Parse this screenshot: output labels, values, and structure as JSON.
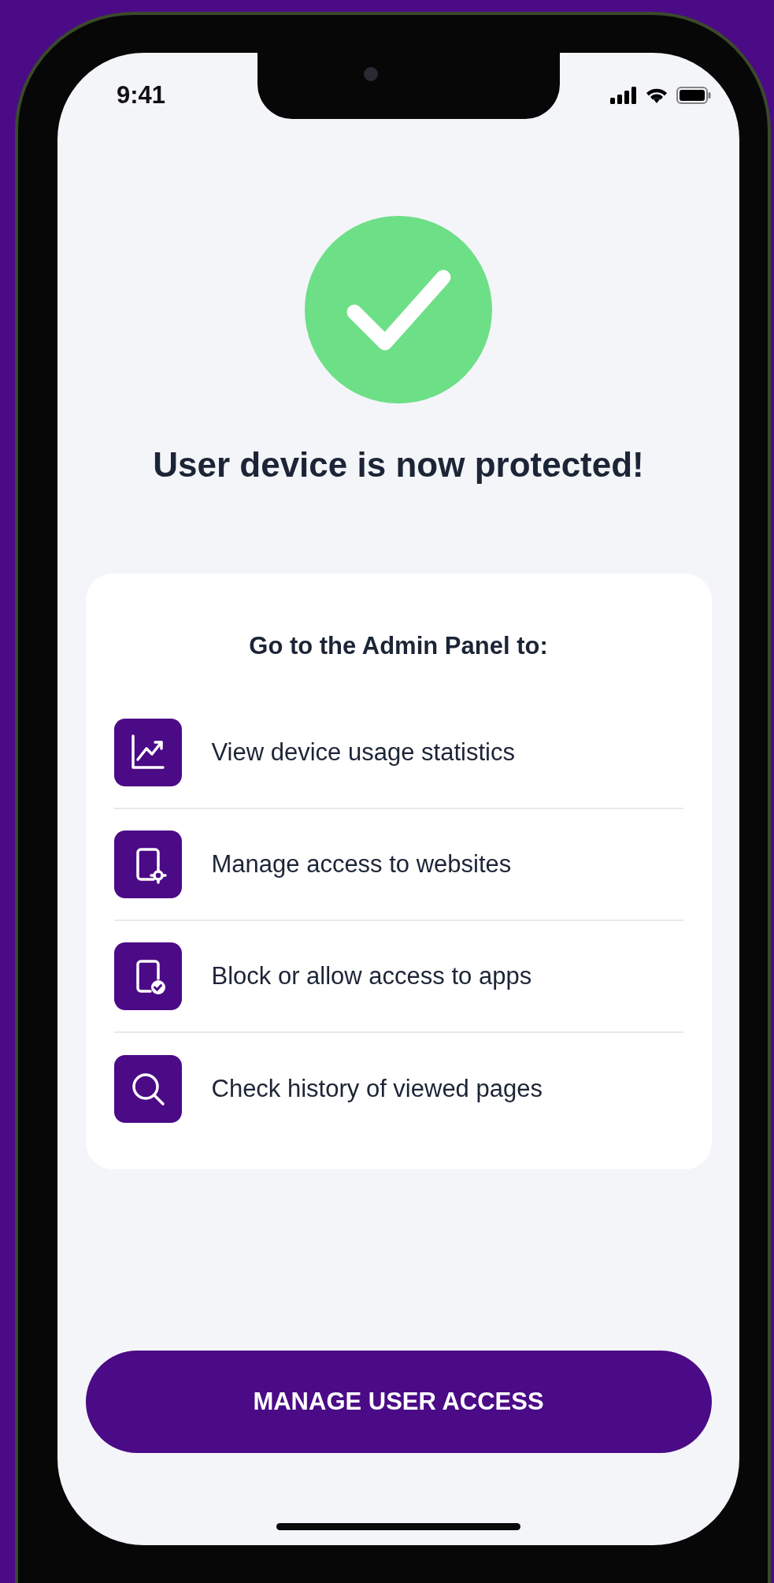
{
  "status_bar": {
    "time": "9:41"
  },
  "title": "User device is now protected!",
  "card": {
    "heading": "Go to the Admin Panel to:",
    "items": [
      {
        "kind": "chart",
        "label": "View device usage statistics"
      },
      {
        "kind": "phone-gear",
        "label": "Manage access to websites"
      },
      {
        "kind": "phone-check",
        "label": "Block or allow access to apps"
      },
      {
        "kind": "search",
        "label": "Check history of viewed pages"
      }
    ]
  },
  "button": {
    "label": "MANAGE USER ACCESS"
  }
}
